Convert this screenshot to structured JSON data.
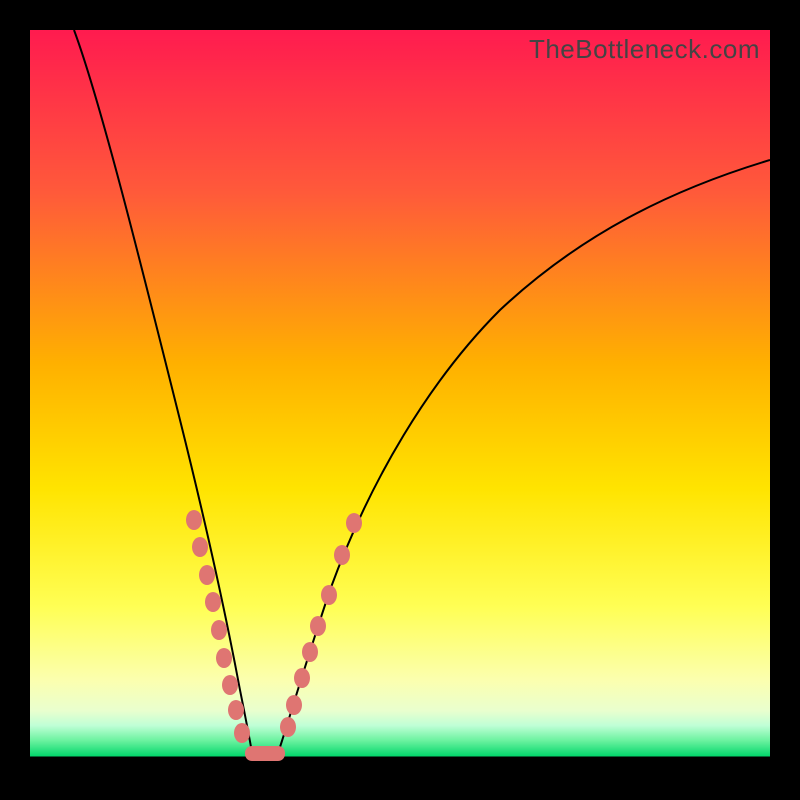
{
  "watermark": "TheBottleneck.com",
  "colors": {
    "top": "#ff1b4f",
    "mid_upper": "#ff7f2a",
    "mid": "#ffd900",
    "mid_lower": "#ffff66",
    "pale": "#f7ffbf",
    "green": "#00d66a",
    "black": "#000000",
    "marker": "#df7572"
  },
  "chart_data": {
    "type": "line",
    "title": "",
    "xlabel": "",
    "ylabel": "",
    "xlim": [
      0,
      100
    ],
    "ylim": [
      0,
      100
    ],
    "series": [
      {
        "name": "left-arm",
        "x": [
          6,
          9,
          12,
          15,
          18,
          20,
          22,
          24,
          25.5,
          26.3,
          27.5,
          28.5,
          29.5
        ],
        "values": [
          100,
          88,
          76,
          64,
          52,
          42,
          33,
          24,
          16,
          11,
          6,
          2,
          0
        ]
      },
      {
        "name": "right-arm",
        "x": [
          33.5,
          34.5,
          36,
          38,
          40,
          44,
          50,
          58,
          68,
          80,
          92,
          100
        ],
        "values": [
          0,
          3,
          8,
          15,
          22,
          33,
          45,
          56,
          66,
          74,
          79,
          82
        ]
      },
      {
        "name": "bottom",
        "x": [
          29.5,
          30.5,
          31.5,
          32.5,
          33.5
        ],
        "values": [
          0,
          0,
          0,
          0,
          0
        ]
      }
    ],
    "markers": {
      "left_cluster": [
        {
          "x": 22.0,
          "y": 33
        },
        {
          "x": 22.8,
          "y": 29
        },
        {
          "x": 23.8,
          "y": 25
        },
        {
          "x": 24.5,
          "y": 21
        },
        {
          "x": 25.3,
          "y": 17
        },
        {
          "x": 26.0,
          "y": 13
        },
        {
          "x": 26.8,
          "y": 10
        },
        {
          "x": 27.5,
          "y": 6
        },
        {
          "x": 28.3,
          "y": 3
        }
      ],
      "bottom_cluster": [
        {
          "x": 29.5,
          "y": 0
        },
        {
          "x": 30.5,
          "y": 0
        },
        {
          "x": 31.5,
          "y": 0
        },
        {
          "x": 32.5,
          "y": 0
        },
        {
          "x": 33.5,
          "y": 0
        }
      ],
      "right_cluster": [
        {
          "x": 34.8,
          "y": 4
        },
        {
          "x": 35.6,
          "y": 7
        },
        {
          "x": 36.6,
          "y": 11
        },
        {
          "x": 37.6,
          "y": 14
        },
        {
          "x": 38.6,
          "y": 18
        },
        {
          "x": 40.2,
          "y": 22
        },
        {
          "x": 42.0,
          "y": 28
        },
        {
          "x": 43.5,
          "y": 32
        }
      ]
    }
  }
}
